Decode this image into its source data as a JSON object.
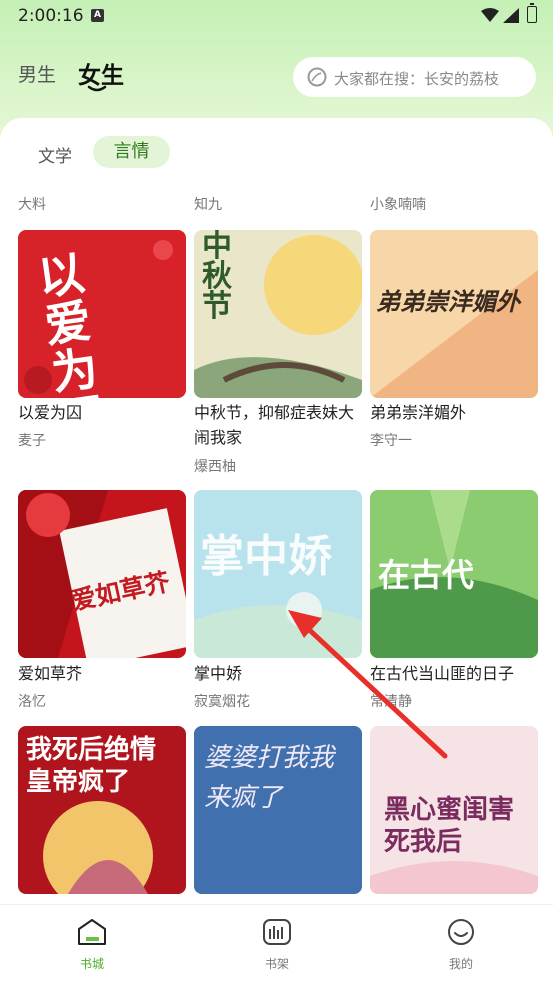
{
  "status_bar": {
    "time": "2:00:16",
    "notification_icon": "A"
  },
  "header": {
    "tabs": [
      {
        "label": "男生"
      },
      {
        "label": "女生"
      }
    ],
    "search_placeholder": "大家都在搜：长安的荔枝"
  },
  "sub_tabs": [
    {
      "label": "文学"
    },
    {
      "label": "言情"
    }
  ],
  "partial_row": {
    "authors": [
      "大料",
      "知九",
      "小象喃喃"
    ]
  },
  "books": [
    {
      "title": "以爱为囚",
      "author": "麦子",
      "cover_text": "以爱为囚"
    },
    {
      "title": "中秋节，抑郁症表妹大闹我家",
      "author": "爆西柚",
      "cover_text": "中秋节"
    },
    {
      "title": "弟弟崇洋媚外",
      "author": "李守一",
      "cover_text": "弟弟崇洋媚外"
    },
    {
      "title": "爱如草芥",
      "author": "洛忆",
      "cover_text": "爱如草芥"
    },
    {
      "title": "掌中娇",
      "author": "寂寞烟花",
      "cover_text": "掌中娇"
    },
    {
      "title": "在古代当山匪的日子",
      "author": "常清静",
      "cover_text": "在古代"
    },
    {
      "title": "",
      "author": "",
      "cover_text": "我死后绝情皇帝疯了"
    },
    {
      "title": "",
      "author": "",
      "cover_text": "婆婆打我我来疯了"
    },
    {
      "title": "",
      "author": "",
      "cover_text": "黑心蜜闺害死我后"
    }
  ],
  "bottom_nav": [
    {
      "label": "书城",
      "active": true
    },
    {
      "label": "书架",
      "active": false
    },
    {
      "label": "我的",
      "active": false
    }
  ],
  "colors": {
    "accent": "#4caf2a",
    "header_bg": "#c4f0b5",
    "pill_bg": "#e3f5d6",
    "annotation_arrow": "#e8302a"
  }
}
